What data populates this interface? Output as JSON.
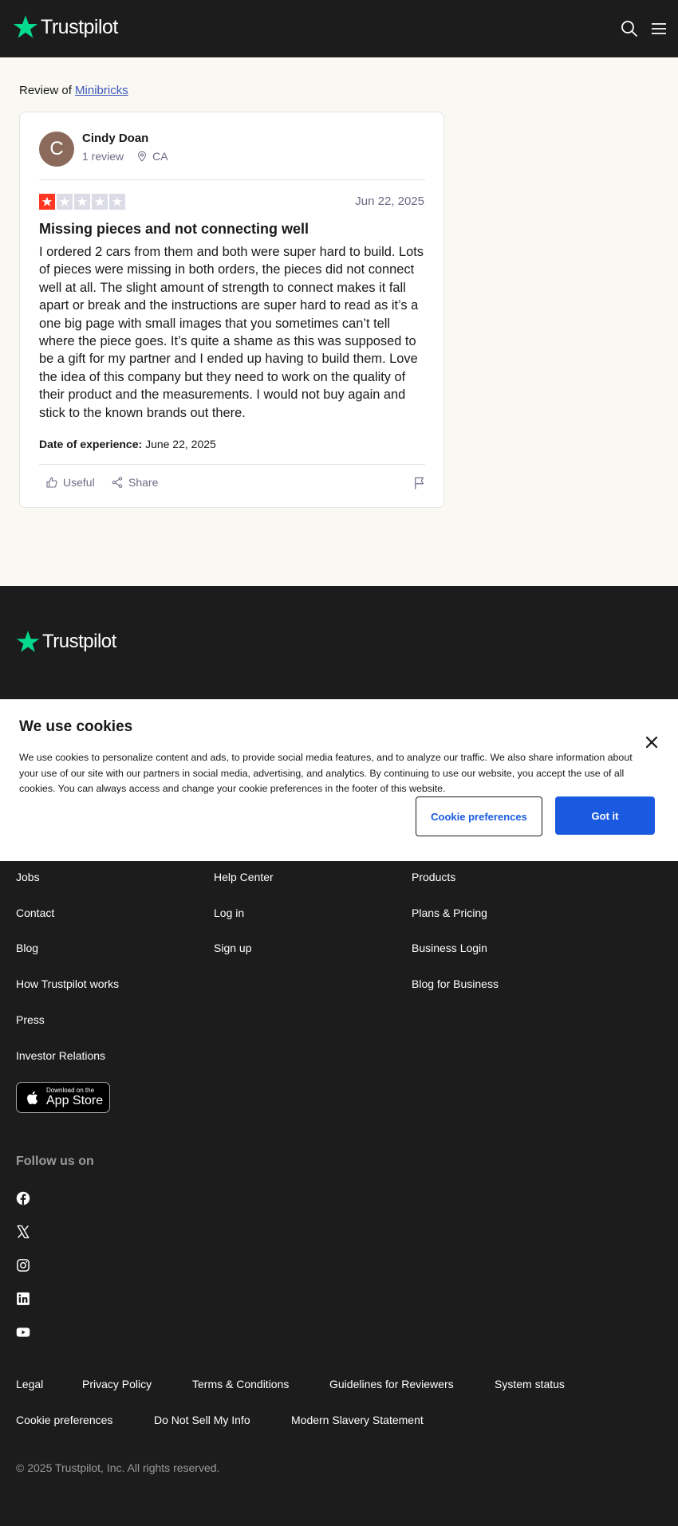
{
  "header": {
    "logo_text": "Trustpilot",
    "search_icon": "search-icon",
    "menu_icon": "menu-icon"
  },
  "review": {
    "prefix": "Review of",
    "company": "Minibricks",
    "reviewer": {
      "initial": "C",
      "name": "Cindy Doan",
      "reviews": "1 review",
      "location": "CA"
    },
    "rating": 1,
    "rating_max": 5,
    "date": "Jun 22, 2025",
    "title": "Missing pieces and not connecting well",
    "body": "I ordered 2 cars from them and both were super hard to build. Lots of pieces were missing in both orders, the pieces did not connect well at all. The slight amount of strength to connect makes it fall apart or break and the instructions are super hard to read as it’s a one big page with small images that you sometimes can’t tell where the piece goes. It’s quite a shame as this was supposed to be a gift for my partner and I ended up having to build them. Love the idea of this company but they need to work on the quality of their product and the measurements. I would not buy again and stick to the known brands out there.",
    "experience_label": "Date of experience:",
    "experience_date": "June 22, 2025",
    "useful_label": "Useful",
    "share_label": "Share"
  },
  "footer": {
    "logo_text": "Trustpilot",
    "col1": [
      "Jobs",
      "Contact",
      "Blog",
      "How Trustpilot works",
      "Press",
      "Investor Relations"
    ],
    "col2": [
      "Help Center",
      "Log in",
      "Sign up"
    ],
    "col3": [
      "Products",
      "Plans & Pricing",
      "Business Login",
      "Blog for Business"
    ],
    "app_store_small": "Download on the",
    "app_store_big": "App Store",
    "follow_title": "Follow us on",
    "social": [
      "facebook-icon",
      "x-icon",
      "instagram-icon",
      "linkedin-icon",
      "youtube-icon"
    ],
    "legal_row1": [
      "Legal",
      "Privacy Policy",
      "Terms & Conditions",
      "Guidelines for Reviewers",
      "System status"
    ],
    "legal_row2": [
      "Cookie preferences",
      "Do Not Sell My Info",
      "Modern Slavery Statement"
    ],
    "copyright": "© 2025 Trustpilot, Inc. All rights reserved."
  },
  "cookie": {
    "title": "We use cookies",
    "text": "We use cookies to personalize content and ads, to provide social media features, and to analyze our traffic. We also share information about your use of our site with our partners in social media, advertising, and analytics. By continuing to use our website, you accept the use of all cookies. You can always access and change your cookie preferences in the footer of this website.",
    "pref_button": "Cookie preferences",
    "ok_button": "Got it"
  },
  "colors": {
    "brand_green": "#04da8d",
    "star_red": "#ff3722",
    "star_empty": "#dcdce6",
    "link_blue": "#3c57bc",
    "button_blue": "#1a5ae0"
  }
}
